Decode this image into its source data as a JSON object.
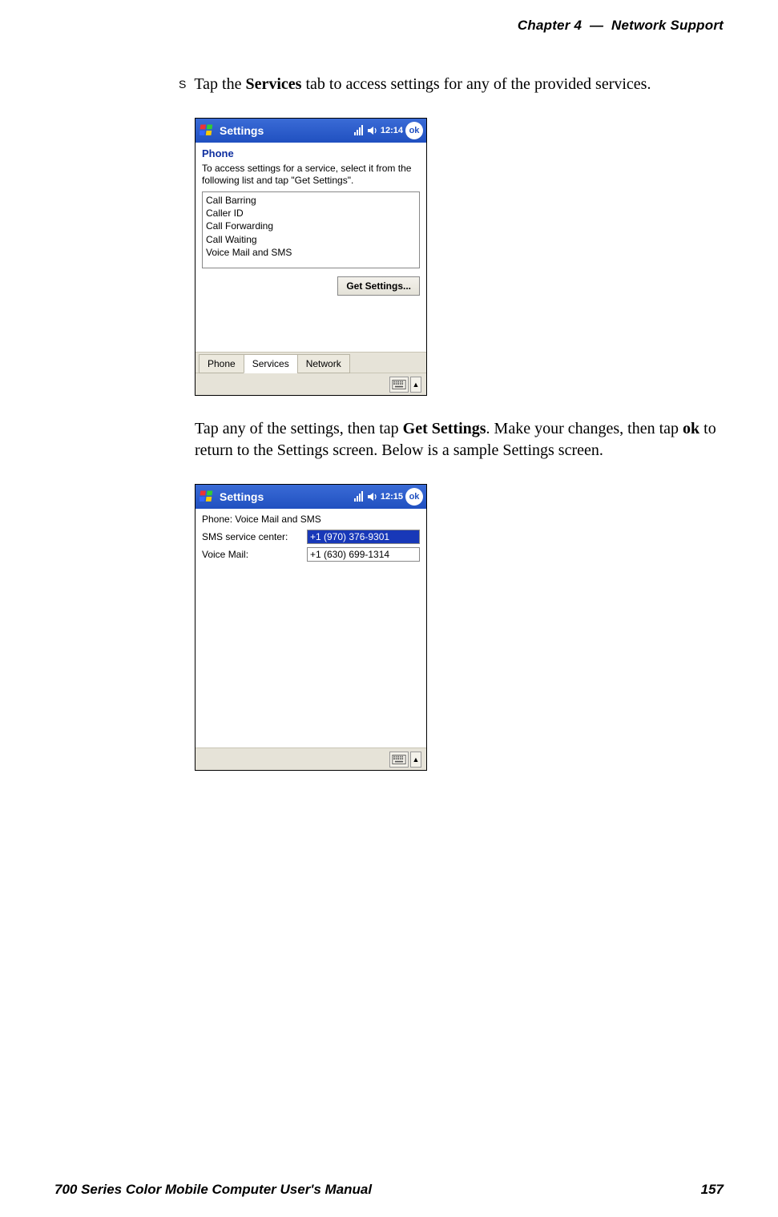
{
  "header": {
    "chapter_label": "Chapter",
    "chapter_num": "4",
    "separator": "—",
    "chapter_title": "Network Support"
  },
  "bullet": {
    "pre": "Tap the ",
    "bold": "Services",
    "post": " tab to access settings for any of the provided services."
  },
  "screenshot1": {
    "title": "Settings",
    "time": "12:14",
    "ok": "ok",
    "subheader": "Phone",
    "instruction": "To access settings for a service, select it from the following list and tap \"Get Settings\".",
    "services": [
      "Call Barring",
      "Caller ID",
      "Call Forwarding",
      "Call Waiting",
      "Voice Mail and SMS"
    ],
    "button": "Get Settings...",
    "tabs": {
      "phone": "Phone",
      "services": "Services",
      "network": "Network"
    }
  },
  "para2": {
    "t1": "Tap any of the settings, then tap ",
    "b1": "Get Settings",
    "t2": ". Make your changes, then tap ",
    "b2": "ok",
    "t3": " to return to the Settings screen. Below is a sample Settings screen."
  },
  "screenshot2": {
    "title": "Settings",
    "time": "12:15",
    "ok": "ok",
    "subheader": "Phone: Voice Mail and SMS",
    "rows": [
      {
        "label": "SMS service center:",
        "value": "+1 (970) 376-9301",
        "selected": true
      },
      {
        "label": "Voice Mail:",
        "value": "+1 (630) 699-1314",
        "selected": false
      }
    ]
  },
  "footer": {
    "left": "700 Series Color Mobile Computer User's Manual",
    "right": "157"
  }
}
